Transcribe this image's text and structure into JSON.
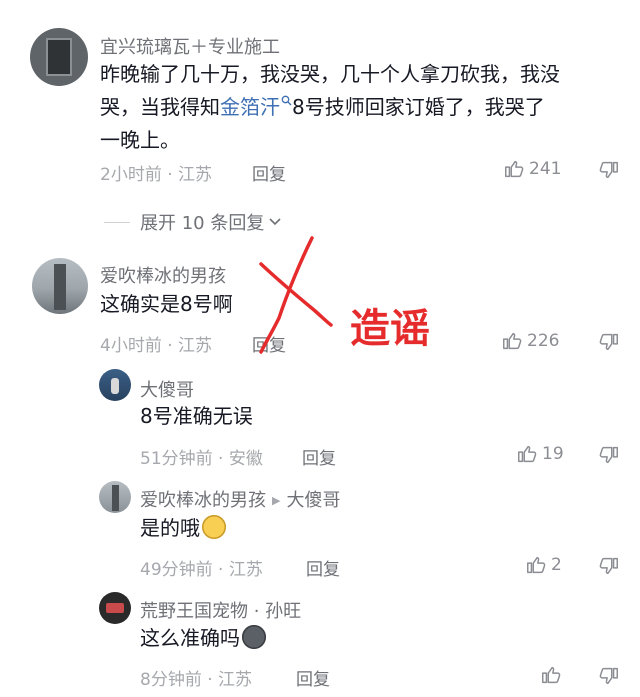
{
  "comments": [
    {
      "username": "宜兴琉璃瓦＋专业施工",
      "content_line1": "昨晚输了几十万，我没哭，几十个人拿刀砍我，我没",
      "content_line2_pre": "哭，当我得知",
      "content_link": "金箔汗",
      "content_line2_post": "8号技师回家订婚了，我哭了",
      "content_line3": "一晚上。",
      "meta": "2小时前 · 江苏",
      "reply_label": "回复",
      "likes": "241"
    }
  ],
  "expand_label": "展开 10 条回复",
  "replies": [
    {
      "username": "爱吹棒冰的男孩",
      "content": "这确实是8号啊",
      "meta": "4小时前 · 江苏",
      "reply_label": "回复",
      "likes": "226"
    },
    {
      "username": "大傻哥",
      "content": "8号准确无误",
      "meta": "51分钟前 · 安徽",
      "reply_label": "回复",
      "likes": "19"
    },
    {
      "username": "爱吹棒冰的男孩",
      "reply_to": "大傻哥",
      "content": "是的哦",
      "meta": "49分钟前 · 江苏",
      "reply_label": "回复",
      "likes": "2"
    },
    {
      "username": "荒野王国宠物 · 孙旺",
      "content": "这么准确吗",
      "meta": "8分钟前 · 江苏",
      "reply_label": "回复",
      "likes": ""
    }
  ],
  "annotation": {
    "text": "造谣",
    "color": "#e52b2b"
  },
  "colors": {
    "link": "#3f6fb3",
    "meta": "#a6a8ad",
    "username": "#6f7177"
  },
  "icons": [
    "thumb-up-icon",
    "thumb-down-icon",
    "search-icon",
    "chevron-down-icon"
  ]
}
